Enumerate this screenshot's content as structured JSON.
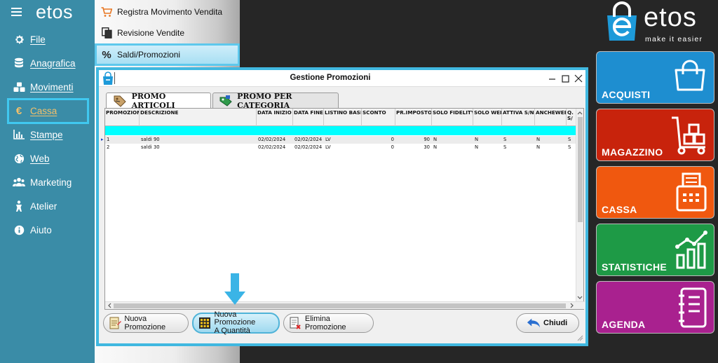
{
  "sidebar": {
    "logo": "etos",
    "items": [
      {
        "label": "File",
        "icon": "gear-icon"
      },
      {
        "label": "Anagrafica",
        "icon": "database-icon"
      },
      {
        "label": "Movimenti",
        "icon": "boxes-icon"
      },
      {
        "label": "Cassa",
        "icon": "euro-icon"
      },
      {
        "label": "Stampe",
        "icon": "bar-chart-icon"
      },
      {
        "label": "Web",
        "icon": "globe-icon"
      },
      {
        "label": "Marketing",
        "icon": "users-icon"
      },
      {
        "label": "Atelier",
        "icon": "person-icon"
      },
      {
        "label": "Aiuto",
        "icon": "info-icon"
      }
    ],
    "active_item": "Cassa",
    "active_color": "#f4c06a",
    "highlight_border": "#40c8f0"
  },
  "submenu": {
    "items": [
      {
        "label": "Registra Movimento Vendita",
        "icon": "cart-icon"
      },
      {
        "label": "Revisione Vendite",
        "icon": "copy-icon"
      },
      {
        "label": "Saldi/Promozioni",
        "icon": "percent-icon"
      }
    ],
    "selected_item": "Saldi/Promozioni"
  },
  "brand": {
    "name": "etos",
    "tagline": "make it easier",
    "color": "#1d9ad9"
  },
  "tiles": [
    {
      "label": "ACQUISTI",
      "color": "#1e8ed0",
      "icon": "shopping-bag-icon"
    },
    {
      "label": "MAGAZZINO",
      "color": "#c8230c",
      "icon": "hand-truck-icon"
    },
    {
      "label": "CASSA",
      "color": "#f0580f",
      "icon": "cash-register-icon"
    },
    {
      "label": "STATISTICHE",
      "color": "#1e9a46",
      "icon": "stats-chart-icon"
    },
    {
      "label": "AGENDA",
      "color": "#a9218f",
      "icon": "notebook-icon"
    }
  ],
  "dialog": {
    "title": "Gestione Promozioni",
    "tabs": [
      {
        "label": "PROMO ARTICOLI",
        "icon": "price-tag-icon",
        "active": true
      },
      {
        "label": "PROMO PER CATEGORIA",
        "icon": "category-tag-icon",
        "active": false
      }
    ],
    "columns": [
      "PROMOZION",
      "DESCRIZIONE",
      "DATA INIZIO",
      "DATA FINE",
      "LISTINO BASE",
      "SCONTO",
      "PR.IMPOSTO",
      "SOLO FIDELITY",
      "SOLO WEB",
      "ATTIVA S/N",
      "ANCHEWEB",
      "Q. S/"
    ],
    "rows": [
      [
        "1",
        "saldi 90",
        "02/02/2024",
        "02/02/2024",
        "LV",
        "0",
        "90",
        "N",
        "N",
        "S",
        "N",
        "S"
      ],
      [
        "2",
        "saldi 30",
        "02/02/2024",
        "02/02/2024",
        "LV",
        "0",
        "30",
        "N",
        "N",
        "S",
        "N",
        "S"
      ]
    ],
    "new_row_color": "#00ffff",
    "buttons": {
      "new_promo": "Nuova Promozione",
      "new_promo_qty_line1": "Nuova Promozione",
      "new_promo_qty_line2": "A Quantità",
      "delete_promo": "Elimina Promozione",
      "close": "Chiudi"
    },
    "highlight_border": "#40b8e0"
  },
  "annotation_arrow_color": "#3ab4e6"
}
